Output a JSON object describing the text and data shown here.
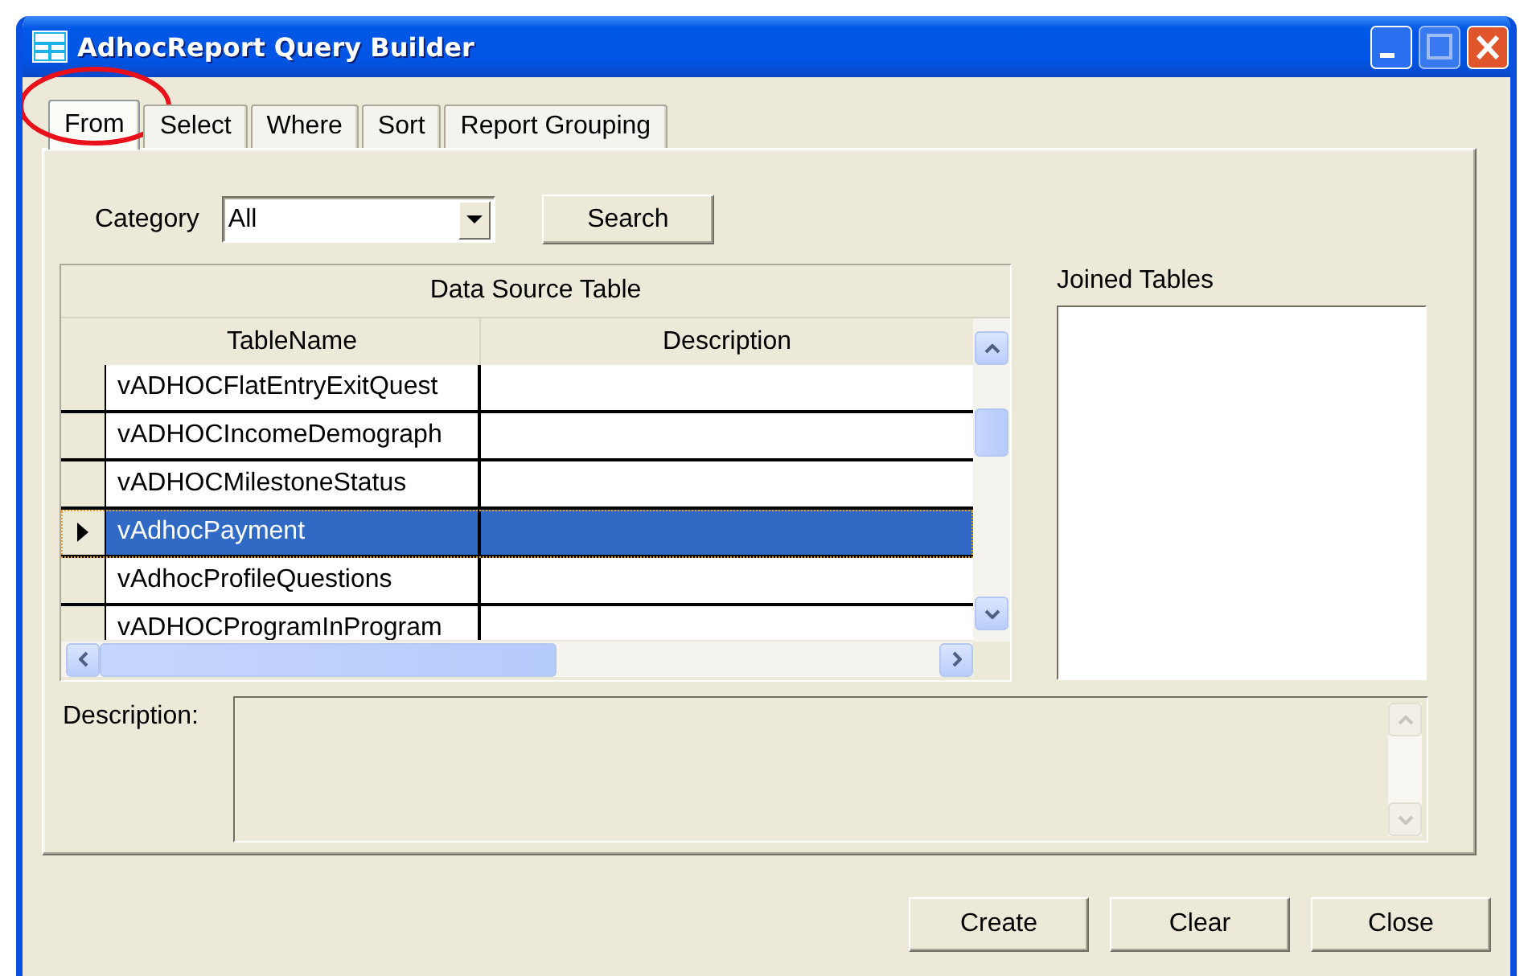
{
  "window": {
    "title": "AdhocReport Query Builder"
  },
  "tabs": [
    {
      "label": "From",
      "selected": true,
      "highlighted": true
    },
    {
      "label": "Select",
      "selected": false,
      "highlighted": false
    },
    {
      "label": "Where",
      "selected": false,
      "highlighted": false
    },
    {
      "label": "Sort",
      "selected": false,
      "highlighted": false
    },
    {
      "label": "Report Grouping",
      "selected": false,
      "highlighted": false
    }
  ],
  "category": {
    "label": "Category",
    "value": "All"
  },
  "search_button": "Search",
  "data_source_table": {
    "caption": "Data Source Table",
    "columns": [
      "TableName",
      "Description"
    ],
    "rows": [
      {
        "table_name": "vADHOCFlatEntryExitQuest",
        "selected": false
      },
      {
        "table_name": "vADHOCIncomeDemograph",
        "selected": false
      },
      {
        "table_name": "vADHOCMilestoneStatus",
        "selected": false
      },
      {
        "table_name": "vAdhocPayment",
        "selected": true
      },
      {
        "table_name": "vAdhocProfileQuestions",
        "selected": false
      },
      {
        "table_name": "vADHOCProgramInProgram",
        "selected": false
      }
    ]
  },
  "joined_tables": {
    "label": "Joined Tables"
  },
  "description": {
    "label": "Description:"
  },
  "buttons": [
    "Create",
    "Clear",
    "Close"
  ]
}
